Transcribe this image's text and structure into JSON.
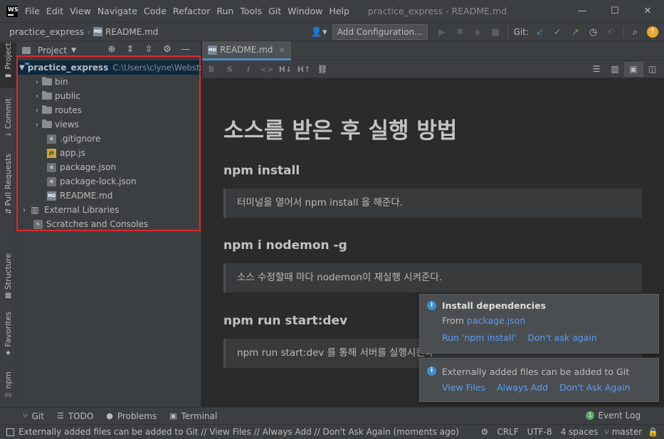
{
  "menubar": {
    "logo_text": "WS",
    "items": [
      "File",
      "Edit",
      "View",
      "Navigate",
      "Code",
      "Refactor",
      "Run",
      "Tools",
      "Git",
      "Window",
      "Help"
    ],
    "window_title": "practice_express - README.md",
    "controls": {
      "minimize": "—",
      "maximize": "☐",
      "close": "✕"
    }
  },
  "navbar": {
    "project": "practice_express",
    "separator": "›",
    "file": "README.md",
    "file_icon": "MD",
    "add_configuration": "Add Configuration...",
    "git_label": "Git:"
  },
  "left_strip": {
    "tabs": [
      "Project",
      "Commit",
      "Pull Requests",
      "Structure",
      "Favorites",
      "npm"
    ]
  },
  "project_panel": {
    "title": "Project",
    "tree": {
      "root_name": "practice_express",
      "root_path": "C:\\Users\\clyne\\WebstormProjects\\practice_express",
      "folders": [
        "bin",
        "public",
        "routes",
        "views"
      ],
      "files": [
        {
          "name": ".gitignore",
          "icon": "CFG"
        },
        {
          "name": "app.js",
          "icon": "JS"
        },
        {
          "name": "package.json",
          "icon": "CFG"
        },
        {
          "name": "package-lock.json",
          "icon": "CFG"
        },
        {
          "name": "README.md",
          "icon": "MD"
        }
      ],
      "external_libraries": "External Libraries",
      "scratches": "Scratches and Consoles"
    }
  },
  "editor": {
    "tab_label": "README.md",
    "tab_icon": "MD",
    "toolbar": [
      "B",
      "S",
      "I",
      "<>",
      "H↓",
      "H↑",
      "🔗"
    ],
    "content": {
      "h1": "소스를 받은 후 실행 방법",
      "sections": [
        {
          "heading": "npm install",
          "quote": "터미널을 열어서 npm install 을 해준다."
        },
        {
          "heading": "npm i nodemon -g",
          "quote": "소스 수정할때 마다 nodemon이 재실행 시켜준다."
        },
        {
          "heading": "npm run start:dev",
          "quote": "npm run start:dev 를 통해 서버를 실행시킨다"
        }
      ]
    }
  },
  "notifications": {
    "install": {
      "title": "Install dependencies",
      "from_label": "From",
      "from_link": "package.json",
      "actions": [
        "Run 'npm install'",
        "Don't ask again"
      ]
    },
    "external": {
      "text": "Externally added files can be added to Git",
      "actions": [
        "View Files",
        "Always Add",
        "Don't Ask Again"
      ]
    }
  },
  "bottom_tools": {
    "items": [
      {
        "label": "Git",
        "icon": "⑂"
      },
      {
        "label": "TODO",
        "icon": "☰"
      },
      {
        "label": "Problems",
        "icon": "●"
      },
      {
        "label": "Terminal",
        "icon": "▣"
      }
    ],
    "event_log": "Event Log",
    "event_count": "1"
  },
  "statusbar": {
    "message": "Externally added files can be added to Git // View Files // Always Add // Don't Ask Again (moments ago)",
    "line_sep": "CRLF",
    "encoding": "UTF-8",
    "indent": "4 spaces",
    "branch": "master"
  },
  "colors": {
    "accent": "#4a88c7",
    "link": "#589df6",
    "highlight_box": "#e0272c",
    "background": "#2b2b2b",
    "panel": "#3c3f41"
  }
}
